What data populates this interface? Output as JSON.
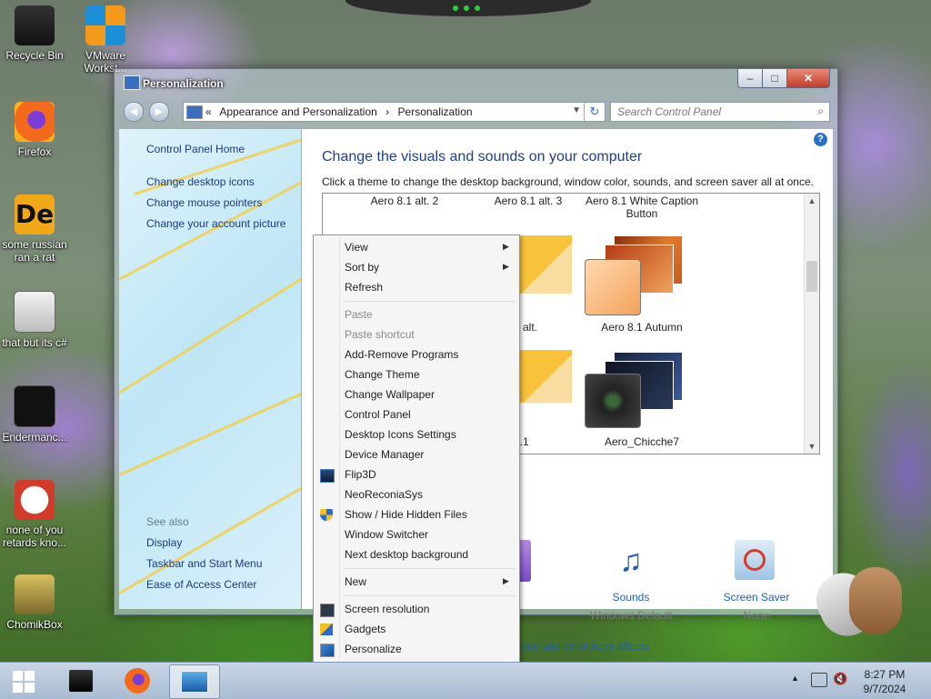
{
  "desktop": {
    "icons": [
      {
        "label": "Recycle Bin"
      },
      {
        "label": "VMware Workst..."
      },
      {
        "label": "Firefox"
      },
      {
        "label": "some russian ran a rat"
      },
      {
        "label": "that but its c#"
      },
      {
        "label": "Endermanc..."
      },
      {
        "label": "none of you retards kno..."
      },
      {
        "label": "ChomikBox"
      }
    ]
  },
  "window": {
    "title": "Personalization",
    "controls": {
      "minimize": "–",
      "maximize": "□",
      "close": "✕"
    },
    "address": {
      "prefix": "«",
      "crumbs": [
        "Appearance and Personalization",
        "›",
        "Personalization"
      ]
    },
    "search_placeholder": "Search Control Panel",
    "left_pane": {
      "home": "Control Panel Home",
      "links": [
        "Change desktop icons",
        "Change mouse pointers",
        "Change your account picture"
      ],
      "see_also": "See also",
      "see_links": [
        "Display",
        "Taskbar and Start Menu",
        "Ease of Access Center"
      ]
    },
    "main": {
      "title": "Change the visuals and sounds on your computer",
      "description": "Click a theme to change the desktop background, window color, sounds, and screen saver all at once.",
      "themes_top": [
        "Aero 8.1 alt. 2",
        "Aero 8.1 alt. 3",
        "Aero 8.1 White Caption Button"
      ],
      "themes_mid": [
        {
          "name": "1 alt."
        },
        {
          "name": "Aero 8.1 Autumn"
        }
      ],
      "themes_bot": [
        {
          "name": "8.1"
        },
        {
          "name": "Aero_Chicche7"
        }
      ],
      "bottom": {
        "color": {
          "label": "Color",
          "sub": "m"
        },
        "sounds": {
          "label": "Sounds",
          "sub": "Windows Default"
        },
        "screensaver": {
          "label": "Screen Saver",
          "sub": "None"
        }
      },
      "aero_link": "ency and other Aero effects"
    }
  },
  "context_menu": {
    "items": [
      {
        "label": "View",
        "submenu": true
      },
      {
        "label": "Sort by",
        "submenu": true
      },
      {
        "label": "Refresh"
      },
      {
        "label": "Paste",
        "disabled": true
      },
      {
        "label": "Paste shortcut",
        "disabled": true
      },
      {
        "label": "Add-Remove Programs"
      },
      {
        "label": "Change Theme"
      },
      {
        "label": "Change Wallpaper"
      },
      {
        "label": "Control Panel"
      },
      {
        "label": "Desktop Icons Settings"
      },
      {
        "label": "Device Manager"
      },
      {
        "label": "Flip3D",
        "icon": "flip3d-icon"
      },
      {
        "label": "NeoReconiaSys"
      },
      {
        "label": "Show / Hide Hidden Files",
        "icon": "shield-icon"
      },
      {
        "label": "Window Switcher"
      },
      {
        "label": "Next desktop background"
      },
      {
        "label": "New",
        "submenu": true
      },
      {
        "label": "Screen resolution",
        "icon": "monitor-icon"
      },
      {
        "label": "Gadgets",
        "icon": "gadgets-icon"
      },
      {
        "label": "Personalize",
        "icon": "personalize-icon"
      }
    ]
  },
  "taskbar": {
    "clock_time": "8:27 PM",
    "clock_date": "9/7/2024",
    "tray_arrow": "▲"
  }
}
